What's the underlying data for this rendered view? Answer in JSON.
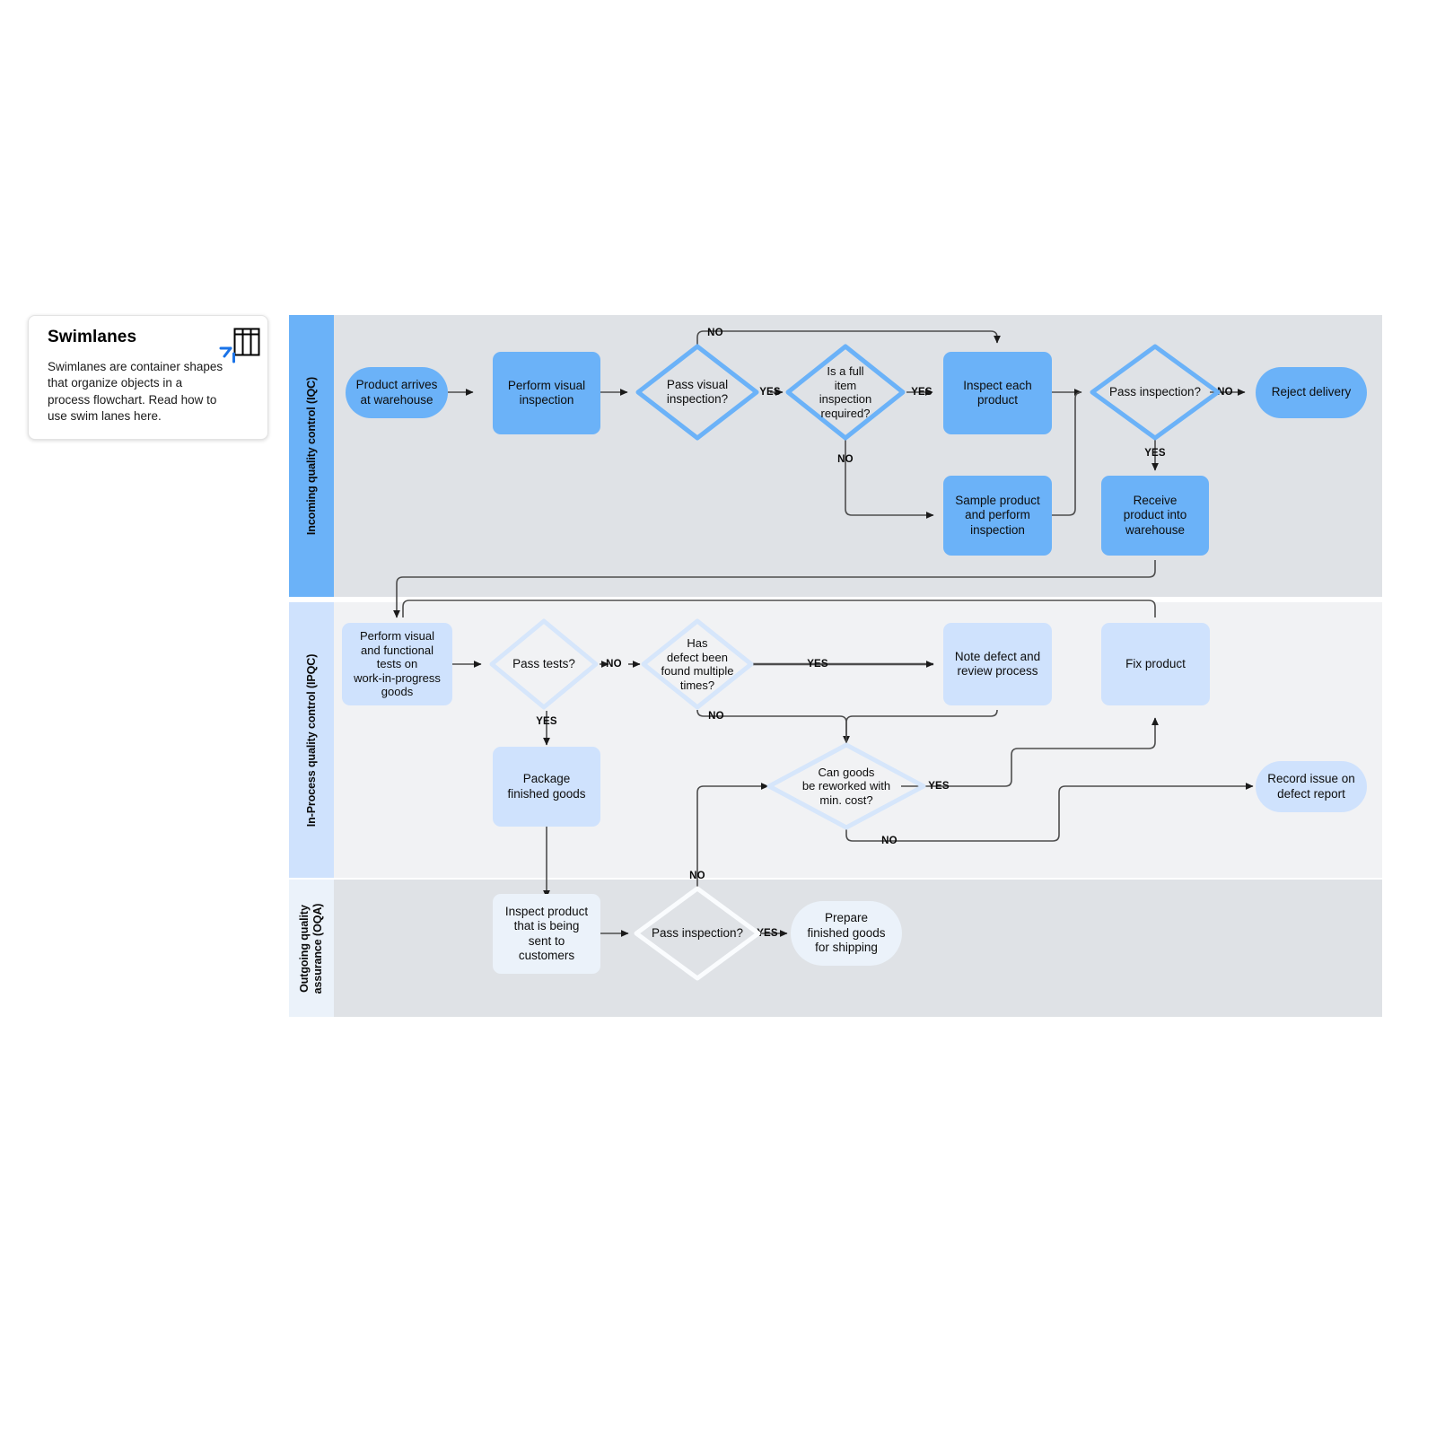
{
  "info_card": {
    "title": "Swimlanes",
    "body": "Swimlanes are container shapes that organize objects in a process flowchart. Read how to use swim lanes here.",
    "icon": "swimlane-table-icon"
  },
  "lanes": [
    {
      "id": "iqc",
      "label": "Incoming quality control (IQC)"
    },
    {
      "id": "ipqc",
      "label": "In-Process quality control (IPQC)"
    },
    {
      "id": "oqa",
      "label": "Outgoing quality\nassurance (OQA)"
    }
  ],
  "nodes": {
    "product_arrives": {
      "text": "Product arrives\nat warehouse",
      "shape": "terminal"
    },
    "perform_visual": {
      "text": "Perform visual\ninspection",
      "shape": "process"
    },
    "pass_visual": {
      "text": "Pass visual\ninspection?",
      "shape": "decision"
    },
    "full_item": {
      "text": "Is a full\nitem\ninspection\nrequired?",
      "shape": "decision"
    },
    "inspect_each": {
      "text": "Inspect each\nproduct",
      "shape": "process"
    },
    "sample_product": {
      "text": "Sample product\nand perform\ninspection",
      "shape": "process"
    },
    "pass_inspection_1": {
      "text": "Pass inspection?",
      "shape": "decision"
    },
    "reject_delivery": {
      "text": "Reject delivery",
      "shape": "terminal"
    },
    "receive_product": {
      "text": "Receive\nproduct into\nwarehouse",
      "shape": "process"
    },
    "perform_tests": {
      "text": "Perform visual\nand functional\ntests on\nwork-in-progress\ngoods",
      "shape": "process"
    },
    "pass_tests": {
      "text": "Pass tests?",
      "shape": "decision"
    },
    "defect_multiple": {
      "text": "Has\ndefect been\nfound multiple\ntimes?",
      "shape": "decision"
    },
    "note_defect": {
      "text": "Note defect and\nreview process",
      "shape": "process"
    },
    "fix_product": {
      "text": "Fix product",
      "shape": "process"
    },
    "package_goods": {
      "text": "Package\nfinished goods",
      "shape": "process"
    },
    "reworked": {
      "text": "Can goods\nbe reworked with\nmin. cost?",
      "shape": "decision"
    },
    "record_issue": {
      "text": "Record issue on\ndefect report",
      "shape": "terminal"
    },
    "inspect_product": {
      "text": "Inspect product\nthat is being\nsent to\ncustomers",
      "shape": "process"
    },
    "pass_inspection_2": {
      "text": "Pass inspection?",
      "shape": "decision"
    },
    "prepare_goods": {
      "text": "Prepare\nfinished goods\nfor shipping",
      "shape": "terminal"
    }
  },
  "edge_labels": {
    "no_pass_visual": "NO",
    "yes_pass_visual": "YES",
    "yes_full_item": "YES",
    "no_full_item": "NO",
    "no_pass_inspection_1": "NO",
    "yes_pass_inspection_1": "YES",
    "no_pass_tests": "NO",
    "yes_pass_tests": "YES",
    "yes_defect_multiple": "YES",
    "no_defect_multiple": "NO",
    "yes_reworked": "YES",
    "no_reworked": "NO",
    "no_pass_inspection_2": "NO",
    "yes_pass_inspection_2": "YES"
  },
  "colors": {
    "lane1_header": "#6BB2F8",
    "lane1_body": "#DFE2E6",
    "lane2_header": "#CFE2FD",
    "lane2_body": "#F1F2F4",
    "lane3_header": "#EBF2FA",
    "lane3_body": "#DFE2E6",
    "shape_lane1": "#6BB2F8",
    "shape_lane2": "#CFE2FD",
    "shape_lane3": "#EBF2FA",
    "connector": "#4D4D4D",
    "card_accent": "#1A73E8"
  }
}
